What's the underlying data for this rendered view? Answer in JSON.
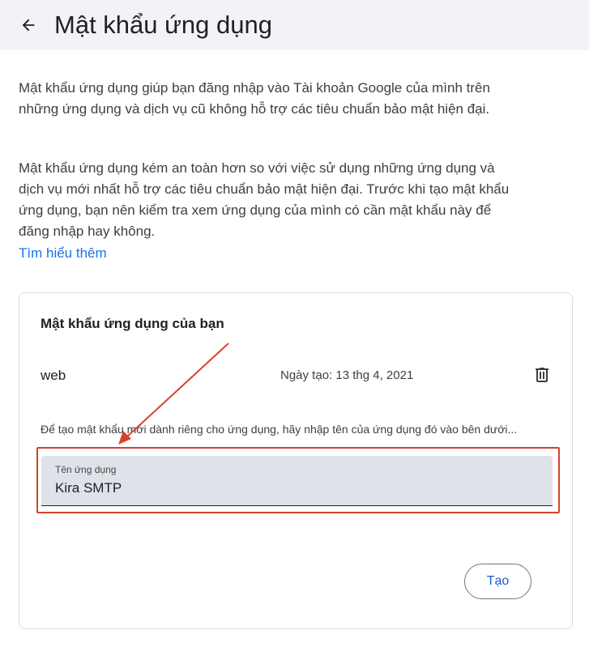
{
  "header": {
    "title": "Mật khẩu ứng dụng"
  },
  "intro": {
    "paragraph1": "Mật khẩu ứng dụng giúp bạn đăng nhập vào Tài khoản Google của mình trên những ứng dụng và dịch vụ cũ không hỗ trợ các tiêu chuẩn bảo mật hiện đại.",
    "paragraph2": "Mật khẩu ứng dụng kém an toàn hơn so với việc sử dụng những ứng dụng và dịch vụ mới nhất hỗ trợ các tiêu chuẩn bảo mật hiện đại. Trước khi tạo mật khẩu ứng dụng, bạn nên kiểm tra xem ứng dụng của mình có cần mật khẩu này để đăng nhập hay không.",
    "learn_more": "Tìm hiểu thêm"
  },
  "card": {
    "title": "Mật khẩu ứng dụng của bạn",
    "passwords": [
      {
        "name": "web",
        "created": "Ngày tạo: 13 thg 4, 2021"
      }
    ],
    "instruction": "Để tạo mật khẩu mới dành riêng cho ứng dụng, hãy nhập tên của ứng dụng đó vào bên dưới...",
    "input": {
      "label": "Tên ứng dụng",
      "value": "Kira SMTP"
    },
    "create_label": "Tạo"
  },
  "colors": {
    "header_bg": "#f1f3f8",
    "link": "#1a73e8",
    "annotation_red": "#d9412e",
    "input_bg": "#dfe3e9"
  },
  "icons": {
    "back": "arrow-left-icon",
    "delete": "trash-icon"
  }
}
